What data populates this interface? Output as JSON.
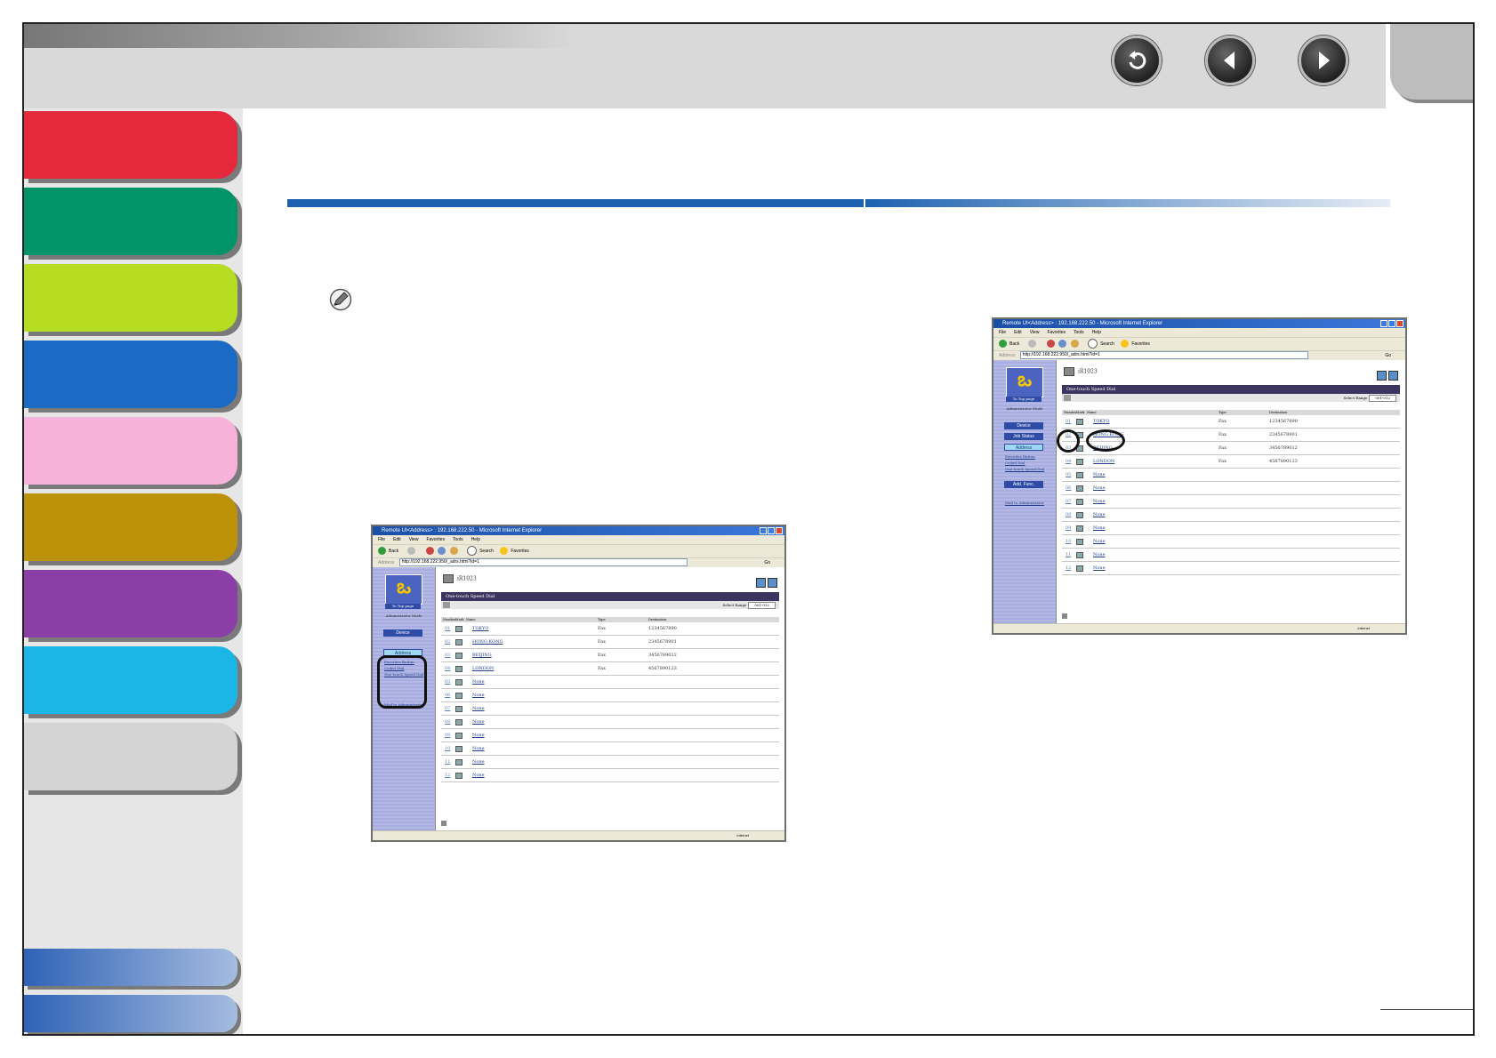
{
  "nav": {
    "back_icon": "return-arrow-icon",
    "prev_icon": "previous-page-icon",
    "next_icon": "next-page-icon"
  },
  "sidebar": {
    "tabs": [
      {
        "color": "#e5283b"
      },
      {
        "color": "#009468"
      },
      {
        "color": "#b6dd22"
      },
      {
        "color": "#1b6bc4"
      },
      {
        "color": "#f7b2da"
      },
      {
        "color": "#bb9208"
      },
      {
        "color": "#8b3ea6"
      },
      {
        "color": "#19b6e6"
      },
      {
        "color": "#d4d4d4"
      }
    ],
    "bottom_tab_color": "#2f63b6"
  },
  "accent_color": "#1d62b0",
  "note_icon": "pencil-note-icon",
  "browser1": {
    "title": "Remote UI<Address> : 192.168.222.50 - Microsoft Internet Explorer",
    "menu": [
      "File",
      "Edit",
      "View",
      "Favorites",
      "Tools",
      "Help"
    ],
    "toolbar": [
      "Back",
      "Search",
      "Favorites"
    ],
    "address_label": "Address",
    "address": "http://192.168.222.950/_adrs.html?id=1",
    "go": "Go",
    "logo_caption": "To Top page",
    "admin_mode": "Administrator Mode",
    "menu_buttons": [
      "Device",
      "Address"
    ],
    "sublinks": [
      "Favorites Button",
      "Coded Dial",
      "One-touch Speed Dial"
    ],
    "mail_link": "Mail to Administrator",
    "device_name": "iR1023",
    "header": "One-touch Speed Dial",
    "select_range_label": "Select Range",
    "select_range_value": "001-012",
    "columns": [
      "Number",
      "Mark",
      "Name",
      "Type",
      "Destination"
    ],
    "rows": [
      {
        "num": "01",
        "name": "TOKYO",
        "type": "Fax",
        "dest": "1234567890"
      },
      {
        "num": "02",
        "name": "HONG KONG",
        "type": "Fax",
        "dest": "2345678901"
      },
      {
        "num": "03",
        "name": "BEIJING",
        "type": "Fax",
        "dest": "3456789012"
      },
      {
        "num": "04",
        "name": "LONDON",
        "type": "Fax",
        "dest": "4567890123"
      },
      {
        "num": "05",
        "name": "None",
        "type": "",
        "dest": ""
      },
      {
        "num": "06",
        "name": "None",
        "type": "",
        "dest": ""
      },
      {
        "num": "07",
        "name": "None",
        "type": "",
        "dest": ""
      },
      {
        "num": "08",
        "name": "None",
        "type": "",
        "dest": ""
      },
      {
        "num": "09",
        "name": "None",
        "type": "",
        "dest": ""
      },
      {
        "num": "10",
        "name": "None",
        "type": "",
        "dest": ""
      },
      {
        "num": "11",
        "name": "None",
        "type": "",
        "dest": ""
      },
      {
        "num": "12",
        "name": "None",
        "type": "",
        "dest": ""
      }
    ],
    "zone": "Internet"
  },
  "browser2": {
    "title": "Remote UI<Address> : 192.168.222.50 - Microsoft Internet Explorer",
    "menu": [
      "File",
      "Edit",
      "View",
      "Favorites",
      "Tools",
      "Help"
    ],
    "toolbar": [
      "Back",
      "Search",
      "Favorites"
    ],
    "address_label": "Address",
    "address": "http://192.168.222.950/_adrs.html?id=1",
    "go": "Go",
    "logo_caption": "To Top page",
    "admin_mode": "Administrator Mode",
    "menu_buttons": [
      "Device",
      "Job Status",
      "Address",
      "Add. Func."
    ],
    "sublinks": [
      "Favorites Button",
      "Coded Dial",
      "One-touch Speed Dial"
    ],
    "mail_link": "Mail to Administrator",
    "device_name": "iR1023",
    "header": "One-touch Speed Dial",
    "select_range_label": "Select Range",
    "select_range_value": "001-012",
    "columns": [
      "Number",
      "Mark",
      "Name",
      "Type",
      "Destination"
    ],
    "rows": [
      {
        "num": "01",
        "name": "TOKYO",
        "type": "Fax",
        "dest": "1234567890"
      },
      {
        "num": "02",
        "name": "HONG KONG",
        "type": "Fax",
        "dest": "2345678901"
      },
      {
        "num": "03",
        "name": "BEIJING",
        "type": "Fax",
        "dest": "3456789012"
      },
      {
        "num": "04",
        "name": "LONDON",
        "type": "Fax",
        "dest": "4567890123"
      },
      {
        "num": "05",
        "name": "None",
        "type": "",
        "dest": ""
      },
      {
        "num": "06",
        "name": "None",
        "type": "",
        "dest": ""
      },
      {
        "num": "07",
        "name": "None",
        "type": "",
        "dest": ""
      },
      {
        "num": "08",
        "name": "None",
        "type": "",
        "dest": ""
      },
      {
        "num": "09",
        "name": "None",
        "type": "",
        "dest": ""
      },
      {
        "num": "10",
        "name": "None",
        "type": "",
        "dest": ""
      },
      {
        "num": "11",
        "name": "None",
        "type": "",
        "dest": ""
      },
      {
        "num": "12",
        "name": "None",
        "type": "",
        "dest": ""
      }
    ],
    "zone": "Internet"
  }
}
